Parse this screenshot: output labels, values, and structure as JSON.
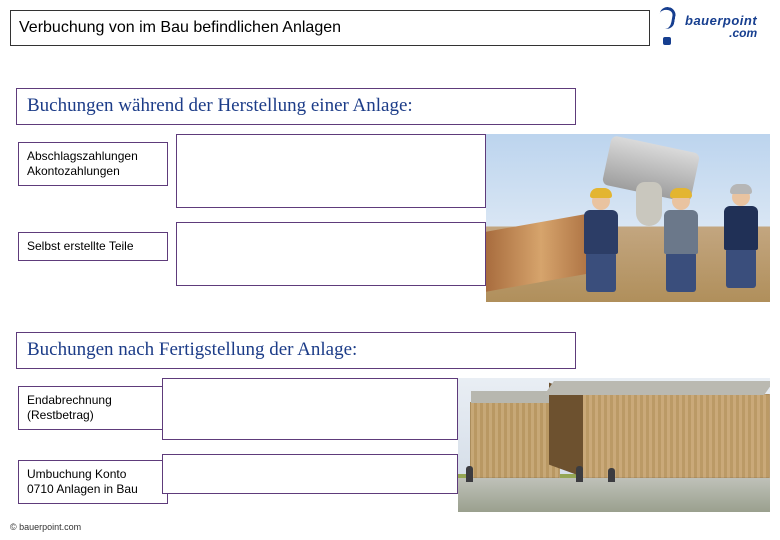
{
  "title": "Verbuchung von im Bau befindlichen Anlagen",
  "logo": {
    "line1": "bauerpoint",
    "line2": ".com"
  },
  "sections": {
    "during": "Buchungen während der Herstellung einer Anlage:",
    "after": "Buchungen nach Fertigstellung der Anlage:"
  },
  "rows": {
    "a": {
      "line1": "Abschlagszahlungen",
      "line2": "Akontozahlungen"
    },
    "b": {
      "line1": "Selbst erstellte Teile"
    },
    "c": {
      "line1": "Endabrechnung",
      "line2": "(Restbetrag)"
    },
    "d": {
      "line1": "Umbuchung Konto",
      "line2": "0710 Anlagen in Bau"
    }
  },
  "footer": "© bauerpoint.com"
}
